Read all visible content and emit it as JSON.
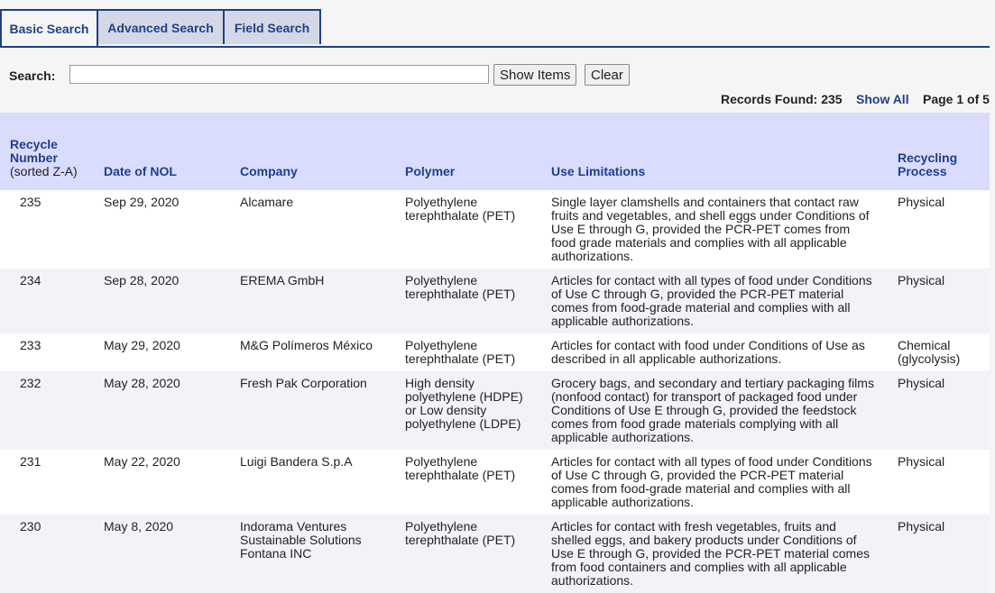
{
  "tabs": [
    {
      "label": "Basic Search"
    },
    {
      "label": "Advanced Search"
    },
    {
      "label": "Field Search"
    }
  ],
  "search": {
    "label": "Search:",
    "value": "",
    "show_items_label": "Show Items",
    "clear_label": "Clear"
  },
  "status": {
    "records_found": "Records Found: 235",
    "show_all": "Show All",
    "page": "Page 1 of 5"
  },
  "table": {
    "headers": {
      "recycle_number": "Recycle Number",
      "recycle_number_sort": "(sorted Z-A)",
      "date": "Date of NOL",
      "company": "Company",
      "polymer": "Polymer",
      "use_limitations": "Use Limitations",
      "process": "Recycling Process"
    },
    "rows": [
      {
        "number": "235",
        "date": "Sep 29, 2020",
        "company": "Alcamare",
        "polymer": "Polyethylene terephthalate (PET)",
        "use": "Single layer clamshells and containers that contact raw fruits and vegetables, and shell eggs under Conditions of Use E through G, provided the PCR-PET comes from food grade materials and complies with all applicable authorizations.",
        "process": "Physical"
      },
      {
        "number": "234",
        "date": "Sep 28, 2020",
        "company": "EREMA GmbH",
        "polymer": "Polyethylene terephthalate (PET)",
        "use": "Articles for contact with all types of food under Conditions of Use C through G, provided the PCR-PET material comes from food-grade material and complies with all applicable authorizations.",
        "process": "Physical"
      },
      {
        "number": "233",
        "date": "May 29, 2020",
        "company": "M&G Polímeros México",
        "polymer": "Polyethylene terephthalate (PET)",
        "use": "Articles for contact with food under Conditions of Use as described in all applicable authorizations.",
        "process": "Chemical (glycolysis)"
      },
      {
        "number": "232",
        "date": "May 28, 2020",
        "company": "Fresh Pak Corporation",
        "polymer": "High density polyethylene (HDPE) or Low density polyethylene (LDPE)",
        "use": "Grocery bags, and secondary and tertiary packaging films (nonfood contact) for transport of packaged food under Conditions of Use E through G, provided the feedstock comes from food grade materials complying with all applicable authorizations.",
        "process": "Physical"
      },
      {
        "number": "231",
        "date": "May 22, 2020",
        "company": "Luigi Bandera S.p.A",
        "polymer": "Polyethylene terephthalate (PET)",
        "use": "Articles for contact with all types of food under Conditions of Use C through G, provided the PCR-PET material comes from food-grade material and complies with all applicable authorizations.",
        "process": "Physical"
      },
      {
        "number": "230",
        "date": "May 8, 2020",
        "company": "Indorama Ventures Sustainable Solutions Fontana INC",
        "polymer": "Polyethylene terephthalate (PET)",
        "use": "Articles for contact with fresh vegetables, fruits and shelled eggs, and bakery products under Conditions of Use E through G, provided the PCR-PET material comes from food containers and complies with all applicable authorizations.",
        "process": "Physical"
      }
    ]
  }
}
